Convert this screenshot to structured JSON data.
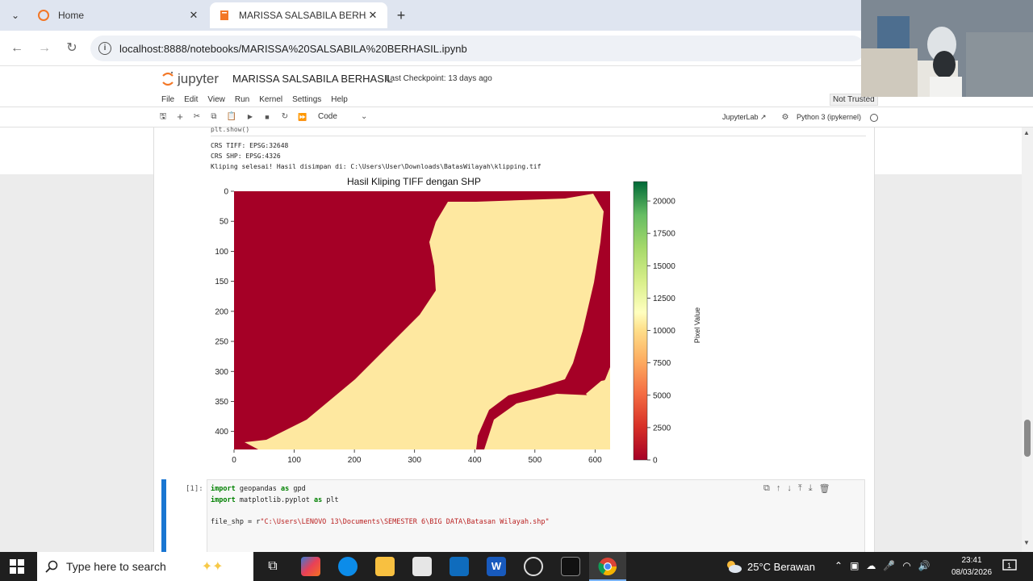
{
  "browser": {
    "tabs": [
      {
        "title": "Home",
        "active": false
      },
      {
        "title": "MARISSA SALSABILA BERHASIL",
        "active": true
      }
    ],
    "url": "localhost:8888/notebooks/MARISSA%20SALSABILA%20BERHASIL.ipynb"
  },
  "jupyter": {
    "logo_text": "jupyter",
    "notebook_title": "MARISSA SALSABILA BERHASIL",
    "checkpoint": "Last Checkpoint: 13 days ago",
    "menu": [
      "File",
      "Edit",
      "View",
      "Run",
      "Kernel",
      "Settings",
      "Help"
    ],
    "trust": "Not Trusted",
    "cell_type": "Code",
    "jupyterlab_link": "JupyterLab",
    "kernel": "Python 3 (ipykernel)"
  },
  "output": {
    "cut_line": "plt.show()",
    "lines": [
      "CRS TIFF: EPSG:32648",
      "CRS SHP: EPSG:4326",
      "Kliping selesai! Hasil disimpan di: C:\\Users\\User\\Downloads\\BatasWilayah\\klipping.tif"
    ]
  },
  "chart_data": {
    "type": "heatmap",
    "title": "Hasil Kliping TIFF dengan SHP",
    "xlabel": "",
    "ylabel": "",
    "x_ticks": [
      0,
      100,
      200,
      300,
      400,
      500,
      600
    ],
    "y_ticks": [
      0,
      50,
      100,
      150,
      200,
      250,
      300,
      350,
      400
    ],
    "xlim": [
      0,
      625
    ],
    "ylim": [
      430,
      0
    ],
    "colormap": "RdYlGn",
    "colorbar": {
      "label": "Pixel Value",
      "ticks": [
        0,
        2500,
        5000,
        7500,
        10000,
        12500,
        15000,
        17500,
        20000
      ],
      "range": [
        0,
        21500
      ]
    },
    "colors": {
      "background_value_color": "#a50026",
      "land_value_color": "#fee8a0"
    }
  },
  "code_cell": {
    "prompt": "[1]:",
    "lines": [
      {
        "kw": "import",
        "rest": " geopandas ",
        "kw2": "as",
        "rest2": " gpd"
      },
      {
        "kw": "import",
        "rest": " matplotlib.pyplot ",
        "kw2": "as",
        "rest2": " plt"
      },
      {
        "kw": "",
        "rest": "",
        "kw2": "",
        "rest2": ""
      },
      {
        "kw": "",
        "rest": "file_shp = r",
        "kw2": "",
        "rest2": "",
        "str": "\"C:\\Users\\LENOVO 13\\Documents\\SEMESTER 6\\BIG DATA\\Batasan Wilayah.shp\""
      }
    ]
  },
  "taskbar": {
    "search_placeholder": "Type here to search",
    "weather": "25°C  Berawan",
    "time": "23:41",
    "date": "08/03/2026"
  }
}
